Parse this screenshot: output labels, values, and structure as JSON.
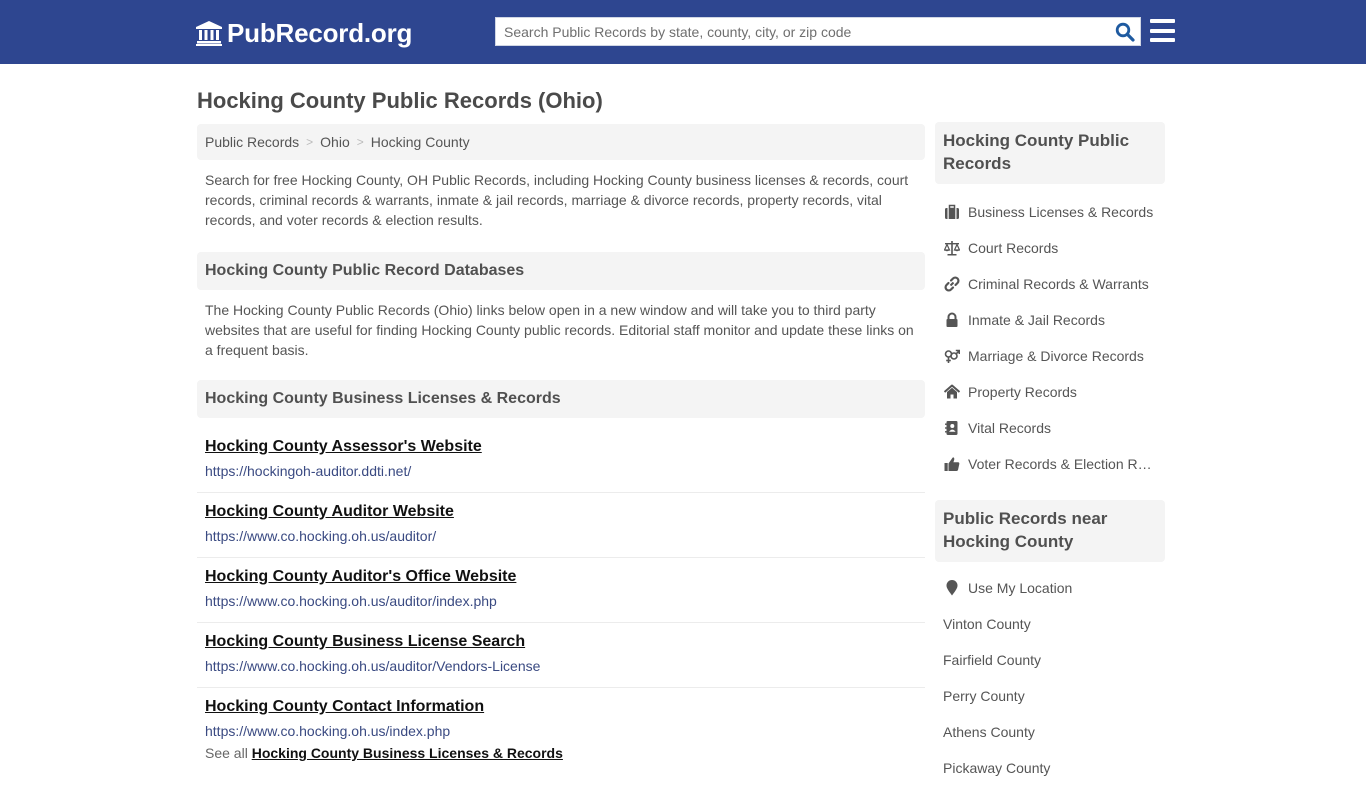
{
  "header": {
    "logo_text": "PubRecord.org",
    "search_placeholder": "Search Public Records by state, county, city, or zip code",
    "brand_color": "#2e4690"
  },
  "page": {
    "title": "Hocking County Public Records (Ohio)"
  },
  "breadcrumb": [
    {
      "label": "Public Records"
    },
    {
      "label": "Ohio"
    },
    {
      "label": "Hocking County"
    }
  ],
  "intro": "Search for free Hocking County, OH Public Records, including Hocking County business licenses & records, court records, criminal records & warrants, inmate & jail records, marriage & divorce records, property records, vital records, and voter records & election results.",
  "databases": {
    "heading": "Hocking County Public Record Databases",
    "description": "The Hocking County Public Records (Ohio) links below open in a new window and will take you to third party websites that are useful for finding Hocking County public records. Editorial staff monitor and update these links on a frequent basis."
  },
  "business": {
    "heading": "Hocking County Business Licenses & Records",
    "links": [
      {
        "title": "Hocking County Assessor's Website",
        "url": "https://hockingoh-auditor.ddti.net/"
      },
      {
        "title": "Hocking County Auditor Website",
        "url": "https://www.co.hocking.oh.us/auditor/"
      },
      {
        "title": "Hocking County Auditor's Office Website",
        "url": "https://www.co.hocking.oh.us/auditor/index.php"
      },
      {
        "title": "Hocking County Business License Search",
        "url": "https://www.co.hocking.oh.us/auditor/Vendors-License"
      },
      {
        "title": "Hocking County Contact Information",
        "url": "https://www.co.hocking.oh.us/index.php"
      }
    ],
    "see_all_prefix": "See all",
    "see_all_link": "Hocking County Business Licenses & Records"
  },
  "sidebar": {
    "records_heading": "Hocking County Public Records",
    "records": [
      {
        "label": "Business Licenses & Records",
        "icon": "briefcase-icon"
      },
      {
        "label": "Court Records",
        "icon": "scale-icon"
      },
      {
        "label": "Criminal Records & Warrants",
        "icon": "link-icon"
      },
      {
        "label": "Inmate & Jail Records",
        "icon": "lock-icon"
      },
      {
        "label": "Marriage & Divorce Records",
        "icon": "gender-icon"
      },
      {
        "label": "Property Records",
        "icon": "home-icon"
      },
      {
        "label": "Vital Records",
        "icon": "contact-book-icon"
      },
      {
        "label": "Voter Records & Election Results",
        "icon": "thumbs-up-icon"
      }
    ],
    "near_heading": "Public Records near Hocking County",
    "use_location": "Use My Location",
    "near": [
      {
        "label": "Vinton County"
      },
      {
        "label": "Fairfield County"
      },
      {
        "label": "Perry County"
      },
      {
        "label": "Athens County"
      },
      {
        "label": "Pickaway County"
      }
    ]
  }
}
